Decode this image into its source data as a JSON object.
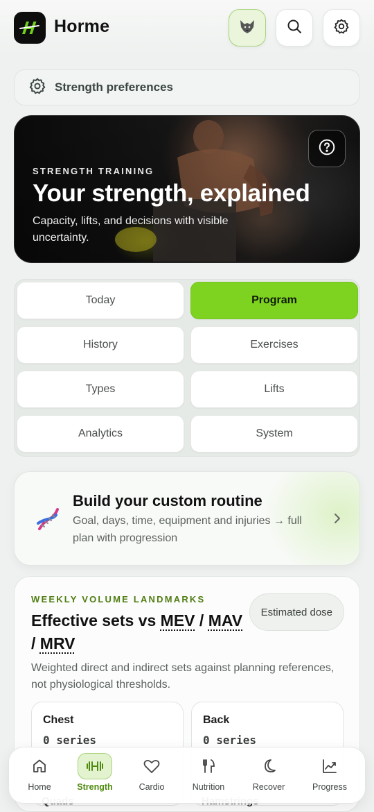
{
  "header": {
    "app_title": "Horme",
    "logo_icon": "horme-logo-icon",
    "buttons": [
      "wolf-icon",
      "search-icon",
      "gear-icon"
    ]
  },
  "preferences": {
    "label": "Strength preferences"
  },
  "hero": {
    "eyebrow": "STRENGTH TRAINING",
    "title": "Your strength, explained",
    "subtitle": "Capacity, lifts, and decisions with visible uncertainty."
  },
  "segments": [
    {
      "label": "Today",
      "active": false
    },
    {
      "label": "Program",
      "active": true
    },
    {
      "label": "History",
      "active": false
    },
    {
      "label": "Exercises",
      "active": false
    },
    {
      "label": "Types",
      "active": false
    },
    {
      "label": "Lifts",
      "active": false
    },
    {
      "label": "Analytics",
      "active": false
    },
    {
      "label": "System",
      "active": false
    }
  ],
  "routine": {
    "title": "Build your custom routine",
    "subtitle": "Goal, days, time, equipment and injuries → full plan with progression"
  },
  "landmarks": {
    "eyebrow": "WEEKLY VOLUME LANDMARKS",
    "title_prefix": "Effective sets vs ",
    "terms": [
      "MEV",
      "MAV",
      "MRV"
    ],
    "sep": " / ",
    "pill": "Estimated dose",
    "description": "Weighted direct and indirect sets against planning references, not physiological thresholds.",
    "muscles": [
      {
        "name": "Chest",
        "value": "0 series"
      },
      {
        "name": "Back",
        "value": "0 series"
      },
      {
        "name": "Quads",
        "value": ""
      },
      {
        "name": "Hamstrings",
        "value": ""
      }
    ]
  },
  "bottom_nav": [
    {
      "label": "Home",
      "icon": "home-icon",
      "active": false
    },
    {
      "label": "Strength",
      "icon": "dumbbell-icon",
      "active": true
    },
    {
      "label": "Cardio",
      "icon": "heart-icon",
      "active": false
    },
    {
      "label": "Nutrition",
      "icon": "utensils-icon",
      "active": false
    },
    {
      "label": "Recover",
      "icon": "moon-icon",
      "active": false
    },
    {
      "label": "Progress",
      "icon": "chart-icon",
      "active": false
    }
  ],
  "colors": {
    "accent": "#7ed321",
    "accent_dark": "#4f8a10",
    "eyebrow_green": "#4f7d12"
  }
}
